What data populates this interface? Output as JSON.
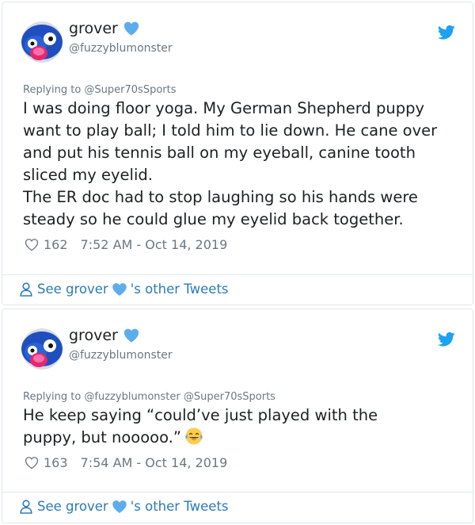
{
  "tweets": [
    {
      "name": "grover",
      "handle": "@fuzzyblumonster",
      "replying_to": "Replying to @Super70sSports",
      "text": "I was doing floor yoga. My German Shepherd  puppy want to play ball; I told him to lie down. He cane over and put his tennis ball on my eyeball, canine tooth sliced my eyelid.\nThe ER doc had to stop laughing so his hands were steady so he could glue my eyelid back together.",
      "likes": "162",
      "timestamp": "7:52 AM - Oct 14, 2019",
      "footer_prefix": "See grover",
      "footer_suffix": "'s other Tweets"
    },
    {
      "name": "grover",
      "handle": "@fuzzyblumonster",
      "replying_to": "Replying to @fuzzyblumonster @Super70sSports",
      "text": "He keep saying “could’ve just played with the puppy, but nooooo.”",
      "likes": "163",
      "timestamp": "7:54 AM - Oct 14, 2019",
      "footer_prefix": "See grover",
      "footer_suffix": "'s other Tweets"
    }
  ],
  "icons": {
    "verified": "blue-heart-icon",
    "platform": "twitter-bird-icon",
    "like": "heart-outline-icon",
    "profile": "person-icon",
    "emoji": "tears-of-joy-emoji"
  },
  "colors": {
    "text": "#1c2022",
    "secondary": "#697882",
    "link": "#2b7bb9",
    "twitter_blue": "#1da1f2",
    "heart_blue": "#5dadec",
    "border": "#e1e8ed"
  }
}
